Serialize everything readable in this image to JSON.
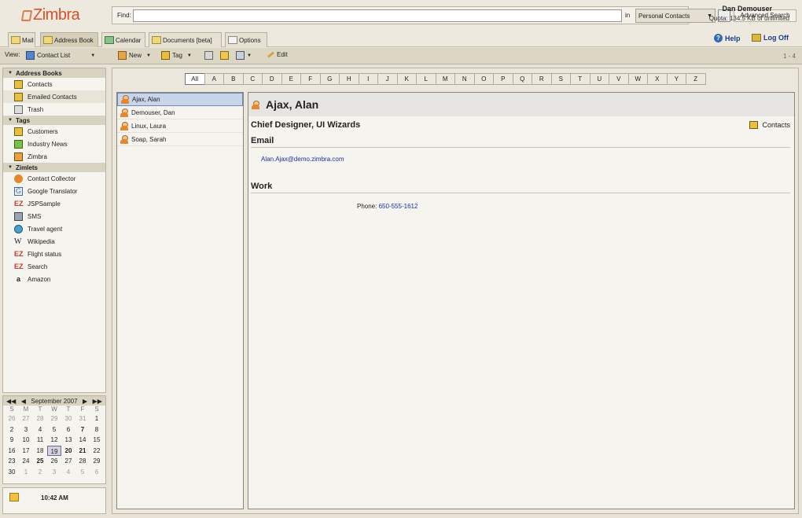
{
  "header": {
    "logo_text": "Zimbra",
    "find_label": "Find:",
    "search_value": "",
    "in_label": "in",
    "scope": "Personal Contacts",
    "advanced_search": "Advanced Search",
    "user_name": "Dan Demouser",
    "quota": "Quota: 134.5 KB of unlimited"
  },
  "tabs": [
    {
      "label": "Mail",
      "icon": "mail-icon"
    },
    {
      "label": "Address Book",
      "icon": "address-book-icon"
    },
    {
      "label": "Calendar",
      "icon": "calendar-icon"
    },
    {
      "label": "Documents [beta]",
      "icon": "documents-icon"
    },
    {
      "label": "Options",
      "icon": "options-icon"
    }
  ],
  "links": {
    "help": "Help",
    "logoff": "Log Off"
  },
  "toolbar": {
    "view_label": "View:",
    "view_value": "Contact List",
    "new_label": "New",
    "tag_label": "Tag",
    "edit_label": "Edit",
    "pager": "1 - 4"
  },
  "sidebar": {
    "address_books_header": "Address Books",
    "address_books": [
      {
        "label": "Contacts",
        "icon": "contacts-icon"
      },
      {
        "label": "Emailed Contacts",
        "icon": "emailed-contacts-icon"
      },
      {
        "label": "Trash",
        "icon": "trash-icon"
      }
    ],
    "tags_header": "Tags",
    "tags": [
      {
        "label": "Customers",
        "icon": "tag-icon"
      },
      {
        "label": "Industry News",
        "icon": "tag-icon"
      },
      {
        "label": "Zimbra",
        "icon": "tag-icon"
      }
    ],
    "zimlets_header": "Zimlets",
    "zimlets": [
      {
        "label": "Contact Collector",
        "icon": "contact-collector-icon"
      },
      {
        "label": "Google Translator",
        "icon": "google-icon"
      },
      {
        "label": "JSPSample",
        "icon": "zimlet-icon"
      },
      {
        "label": "SMS",
        "icon": "sms-icon"
      },
      {
        "label": "Travel agent",
        "icon": "globe-icon"
      },
      {
        "label": "Wikipedia",
        "icon": "wikipedia-icon"
      },
      {
        "label": "Flight status",
        "icon": "zimlet-icon"
      },
      {
        "label": "Search",
        "icon": "zimlet-icon"
      },
      {
        "label": "Amazon",
        "icon": "amazon-icon"
      }
    ]
  },
  "calendar": {
    "month": "September 2007",
    "weekdays": [
      "S",
      "M",
      "T",
      "W",
      "T",
      "F",
      "S"
    ],
    "days": [
      {
        "d": "26",
        "c": "other"
      },
      {
        "d": "27",
        "c": "other"
      },
      {
        "d": "28",
        "c": "other"
      },
      {
        "d": "29",
        "c": "other"
      },
      {
        "d": "30",
        "c": "other"
      },
      {
        "d": "31",
        "c": "other"
      },
      {
        "d": "1",
        "c": ""
      },
      {
        "d": "2",
        "c": ""
      },
      {
        "d": "3",
        "c": ""
      },
      {
        "d": "4",
        "c": ""
      },
      {
        "d": "5",
        "c": ""
      },
      {
        "d": "6",
        "c": ""
      },
      {
        "d": "7",
        "c": "bold"
      },
      {
        "d": "8",
        "c": ""
      },
      {
        "d": "9",
        "c": ""
      },
      {
        "d": "10",
        "c": ""
      },
      {
        "d": "11",
        "c": ""
      },
      {
        "d": "12",
        "c": ""
      },
      {
        "d": "13",
        "c": ""
      },
      {
        "d": "14",
        "c": ""
      },
      {
        "d": "15",
        "c": ""
      },
      {
        "d": "16",
        "c": ""
      },
      {
        "d": "17",
        "c": ""
      },
      {
        "d": "18",
        "c": ""
      },
      {
        "d": "19",
        "c": "today"
      },
      {
        "d": "20",
        "c": "bold"
      },
      {
        "d": "21",
        "c": "bold"
      },
      {
        "d": "22",
        "c": ""
      },
      {
        "d": "23",
        "c": ""
      },
      {
        "d": "24",
        "c": ""
      },
      {
        "d": "25",
        "c": "bold"
      },
      {
        "d": "26",
        "c": ""
      },
      {
        "d": "27",
        "c": ""
      },
      {
        "d": "28",
        "c": ""
      },
      {
        "d": "29",
        "c": ""
      },
      {
        "d": "30",
        "c": ""
      },
      {
        "d": "1",
        "c": "other"
      },
      {
        "d": "2",
        "c": "other"
      },
      {
        "d": "3",
        "c": "other"
      },
      {
        "d": "4",
        "c": "other"
      },
      {
        "d": "5",
        "c": "other"
      },
      {
        "d": "6",
        "c": "other"
      }
    ]
  },
  "clock": {
    "time": "10:42 AM"
  },
  "alphabet": [
    "All",
    "A",
    "B",
    "C",
    "D",
    "E",
    "F",
    "G",
    "H",
    "I",
    "J",
    "K",
    "L",
    "M",
    "N",
    "O",
    "P",
    "Q",
    "R",
    "S",
    "T",
    "U",
    "V",
    "W",
    "X",
    "Y",
    "Z"
  ],
  "contacts": [
    "Ajax, Alan",
    "Demouser, Dan",
    "Linux, Laura",
    "Soap, Sarah"
  ],
  "detail": {
    "name": "Ajax, Alan",
    "title": "Chief Designer, UI Wizards",
    "folder": "Contacts",
    "email_header": "Email",
    "email": "Alan.Ajax@demo.zimbra.com",
    "work_header": "Work",
    "phone_label": "Phone:",
    "phone": "650-555-1612"
  },
  "colors": {
    "logo": "#d8502a",
    "link": "#1a2fa8",
    "selection": "#c8d4ea"
  }
}
